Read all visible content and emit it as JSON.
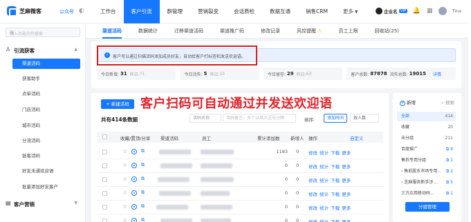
{
  "app": {
    "brand": "芝麻微客",
    "account_label": "公众号"
  },
  "nav": {
    "items": [
      {
        "label": "工作台"
      },
      {
        "label": "客户引流",
        "active": true
      },
      {
        "label": "群管理"
      },
      {
        "label": "营销裂变"
      },
      {
        "label": "会话质检"
      },
      {
        "label": "数据互通"
      },
      {
        "label": "销售CRM"
      },
      {
        "label": "更多"
      }
    ]
  },
  "topright": {
    "account_name": "企业名",
    "account_tag": "VIP",
    "user_name": "Tina"
  },
  "sidebar": {
    "search_placeholder": "输入功能名称搜索",
    "group1": "引流获客",
    "items": [
      "渠道活码",
      "获客助手",
      "点单活码",
      "门店活码",
      "城市活码",
      "分流活码",
      "链客活码",
      "好友未通欢迎语",
      "批量添加好友客户"
    ],
    "group2": "客户营销"
  },
  "subtabs": [
    {
      "label": "渠道活码",
      "active": true
    },
    {
      "label": "数据统计"
    },
    {
      "label": "迁移渠道活码"
    },
    {
      "label": "渠道推广码"
    },
    {
      "label": "修改记录"
    },
    {
      "label": "风控提醒",
      "warn": "⚠"
    },
    {
      "label": "员工上限"
    },
    {
      "label": "回收站(25)"
    }
  ],
  "notice": "客户可以通过扫描活码添加成员好友，自动给客户打标签和发送欢迎语。",
  "stats": {
    "new_today_label": "今日新增:",
    "new_today": "31",
    "new_yesterday_label": "昨日:",
    "new_yesterday": "71",
    "lost_today_label": "今日流失:",
    "lost_today": "5",
    "lost_yesterday_label": "昨日:",
    "lost_yesterday": "10",
    "kept_today_label": "今日留存:",
    "kept_today": "29",
    "kept_yesterday_label": "昨日:",
    "kept_yesterday": "63",
    "total_label": "客户总数:",
    "total": "87878",
    "lost_total_label": "流失总数:",
    "lost_total": "19015",
    "detail_link": "详情"
  },
  "overlay_text": "客户扫码可自动通过并发送欢迎语",
  "table": {
    "new_button": "+ 新建活码",
    "total_text": "共有414条数据",
    "filter_type": "活码名称",
    "filter_placeholder": "活码备注、多个以英文逗号分隔",
    "sort_label": "排序:",
    "sort_value": "添加时间",
    "sort_user": "按人数",
    "headers": [
      "收藏/置顶/分享",
      "渠道活码",
      "员工",
      "累计添加数",
      "新增人",
      "操作",
      "自定义"
    ],
    "rows": [
      {
        "count": "1183",
        "new": "0",
        "ops": "修改 统计 下载 更多"
      },
      {
        "count": "0",
        "new": "0",
        "ops": "修改 统计 下载 更多"
      },
      {
        "count": "0",
        "new": "0",
        "ops": "修改 统计 下载 更多"
      },
      {
        "count": "0",
        "new": "0",
        "ops": "修改 统计 下载 更多"
      },
      {
        "count": "0",
        "new": "0",
        "ops": "修改 统计 下载 更多"
      },
      {
        "count": "0",
        "new": "0",
        "ops": "修改 统计 下载 更多"
      }
    ]
  },
  "groups": {
    "new_label": "新增",
    "search_label": "搜索",
    "items": [
      {
        "label": "全部",
        "count": "414",
        "active": true
      },
      {
        "label": "收藏",
        "count": "20"
      },
      {
        "label": "未分组",
        "count": "211"
      },
      {
        "label": "百度推广",
        "count": "9",
        "link": true
      },
      {
        "label": "售后专用分组",
        "count": "1",
        "link": false
      },
      {
        "label": "› 售前股东市场专用...",
        "count": "2",
        "link": false
      },
      {
        "label": "› 芝麻服务新手涉...",
        "count": "5",
        "link": false
      },
      {
        "label": "三方应用移动码...",
        "count": "1",
        "link": false
      }
    ],
    "manage_button": "分组管理"
  }
}
